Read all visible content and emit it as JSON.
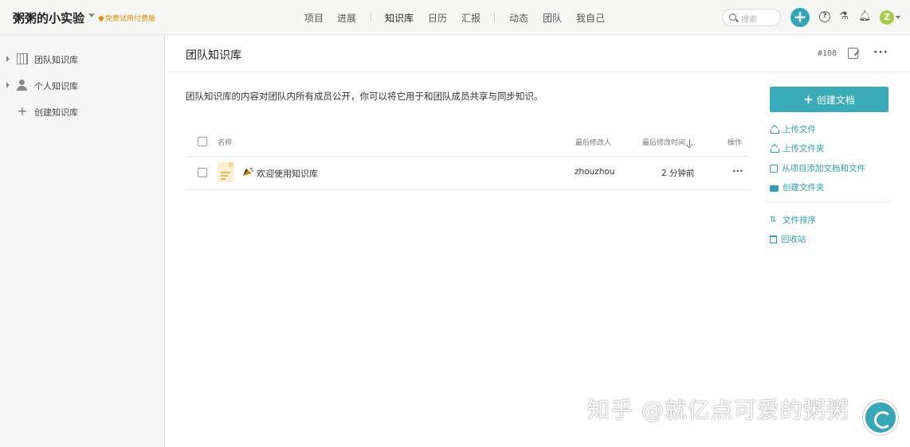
{
  "header": {
    "workspace_name": "粥粥的小实验",
    "trial_label": "免费试用付费版",
    "nav": [
      "项目",
      "进展",
      "知识库",
      "日历",
      "汇报",
      "动态",
      "团队",
      "我自己"
    ],
    "active_nav": "知识库",
    "search_placeholder": "搜索",
    "avatar_letter": "Z",
    "accent_color": "#2fa5b6"
  },
  "sidebar": {
    "items": [
      {
        "label": "团队知识库",
        "icon": "building-icon"
      },
      {
        "label": "个人知识库",
        "icon": "person-icon"
      },
      {
        "label": "创建知识库",
        "icon": "plus-icon"
      }
    ]
  },
  "main": {
    "title": "团队知识库",
    "doc_number": "#108",
    "description": "团队知识库的内容对团队内所有成员公开，你可以将它用于和团队成员共享与同步知识。",
    "table": {
      "headers": {
        "name": "名称",
        "modifier": "最后修改人",
        "modified_time": "最后修改时间",
        "actions": "操作"
      },
      "rows": [
        {
          "name": "欢迎使用知识库",
          "modifier": "zhouzhou",
          "modified_time": "2 分钟前",
          "more": "···"
        }
      ]
    }
  },
  "actions_panel": {
    "create_button": "创建文档",
    "links": [
      "上传文件",
      "上传文件夹",
      "从项目添加文档和文件",
      "创建文件夹"
    ],
    "links2": [
      "文件排序",
      "回收站"
    ]
  },
  "watermark": "知乎 @就亿点可爱的粥粥"
}
